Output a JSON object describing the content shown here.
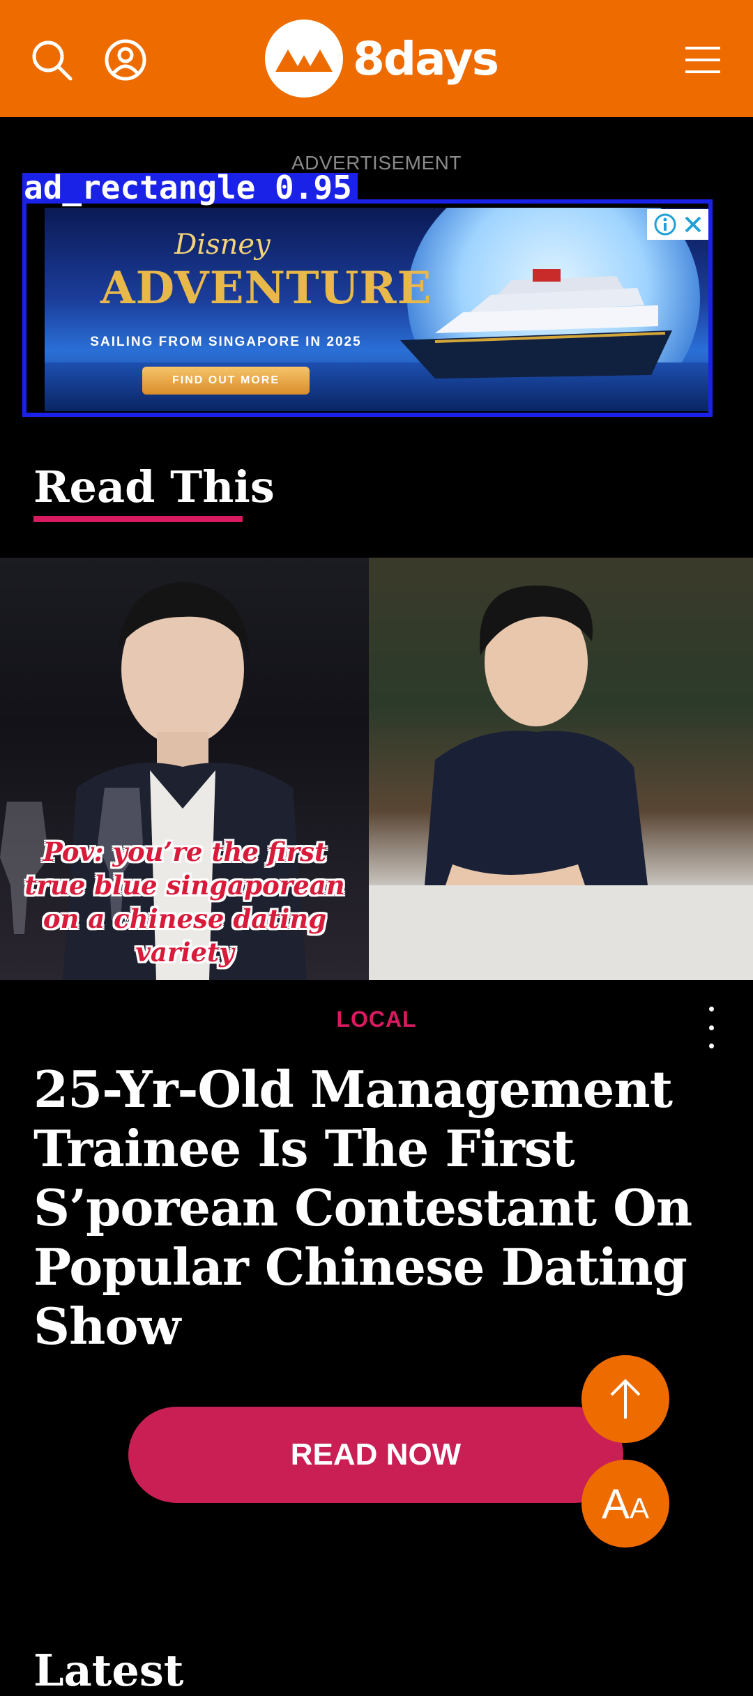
{
  "header": {
    "brand": "8days",
    "icons": {
      "search": "search-icon",
      "profile": "user-icon",
      "menu": "hamburger-menu-icon"
    },
    "colors": {
      "background": "#EE6B00"
    }
  },
  "ad": {
    "label": "ADVERTISEMENT",
    "detection_tag": "ad_rectangle  0.95",
    "brand": "Disney",
    "title": "ADVENTURE",
    "subtitle": "SAILING FROM SINGAPORE IN 2025",
    "cta": "FIND OUT MORE"
  },
  "section": {
    "title": "Read This"
  },
  "article": {
    "image_caption": "Pov: you’re the first true blue singaporean on a chinese dating variety",
    "category": "LOCAL",
    "headline": "25-Yr-Old Management Trainee Is The First S’porean Contestant On Popular Chinese Dating Show",
    "cta": "READ NOW"
  },
  "fabs": {
    "font_size_label": "AA",
    "scroll_top": "arrow-up-icon"
  },
  "next_section": {
    "title": "Latest"
  },
  "colors": {
    "accent": "#D81B60",
    "button": "#C91F55",
    "orange": "#EE6B00"
  }
}
